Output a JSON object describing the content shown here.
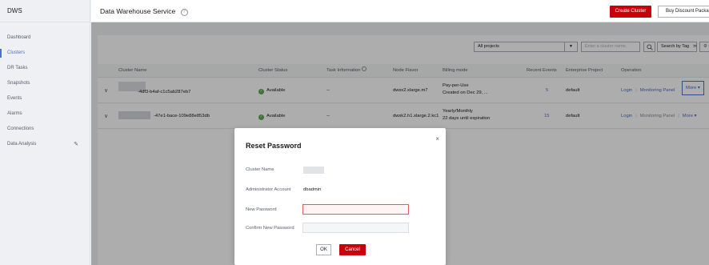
{
  "sidebar": {
    "title": "DWS",
    "items": [
      {
        "label": "Dashboard"
      },
      {
        "label": "Clusters"
      },
      {
        "label": "DR Tasks"
      },
      {
        "label": "Snapshots"
      },
      {
        "label": "Events"
      },
      {
        "label": "Alarms"
      },
      {
        "label": "Connections"
      },
      {
        "label": "Data Analysis"
      }
    ]
  },
  "header": {
    "title": "Data Warehouse Service",
    "help_glyph": "?",
    "create_label": "Create Cluster",
    "discount_label": "Buy Discount Package"
  },
  "filters": {
    "projects_value": "All projects",
    "search_placeholder": "Enter a cluster name.",
    "tag_label": "Search by Tag",
    "tag_caret": "≫"
  },
  "table": {
    "columns": [
      "Cluster Name",
      "Cluster Status",
      "Task Information",
      "Node Flavor",
      "Billing mode",
      "Recent Events",
      "Enterprise Project",
      "Operation"
    ],
    "rows": [
      {
        "name_suffix": "-4df3-b4af-c1c5ab287eb7",
        "status": "Available",
        "task": "--",
        "flavor": "dwsx2.xlarge.m7",
        "billing_line1": "Pay-per-Use",
        "billing_line2": "Created on Dec 29, ...",
        "events": "5",
        "project": "default",
        "op_login": "Login",
        "op_monitor": "Monitoring Panel",
        "op_more": "More ▾"
      },
      {
        "name_suffix": "-47e1-bace-109e88e853db",
        "status": "Available",
        "task": "--",
        "flavor": "dwsk2.h1.xlarge.2.kc1",
        "billing_line1": "Yearly/Monthly",
        "billing_line2": "22 days until expiration",
        "events": "15",
        "project": "default",
        "op_login": "Login",
        "op_monitor": "Monitoring Panel",
        "op_more": "More ▾"
      }
    ]
  },
  "dialog": {
    "title": "Reset Password",
    "close": "×",
    "cluster_name_label": "Cluster Name",
    "admin_label": "Administrator Account",
    "admin_value": "dbadmin",
    "new_pw_label": "New Password",
    "confirm_pw_label": "Confirm New Password",
    "ok_label": "OK",
    "cancel_label": "Cancel"
  },
  "colors": {
    "brand_red": "#c7000b",
    "link_blue": "#526ecc",
    "status_green": "#5ea94e",
    "error_border": "#e35a63"
  }
}
